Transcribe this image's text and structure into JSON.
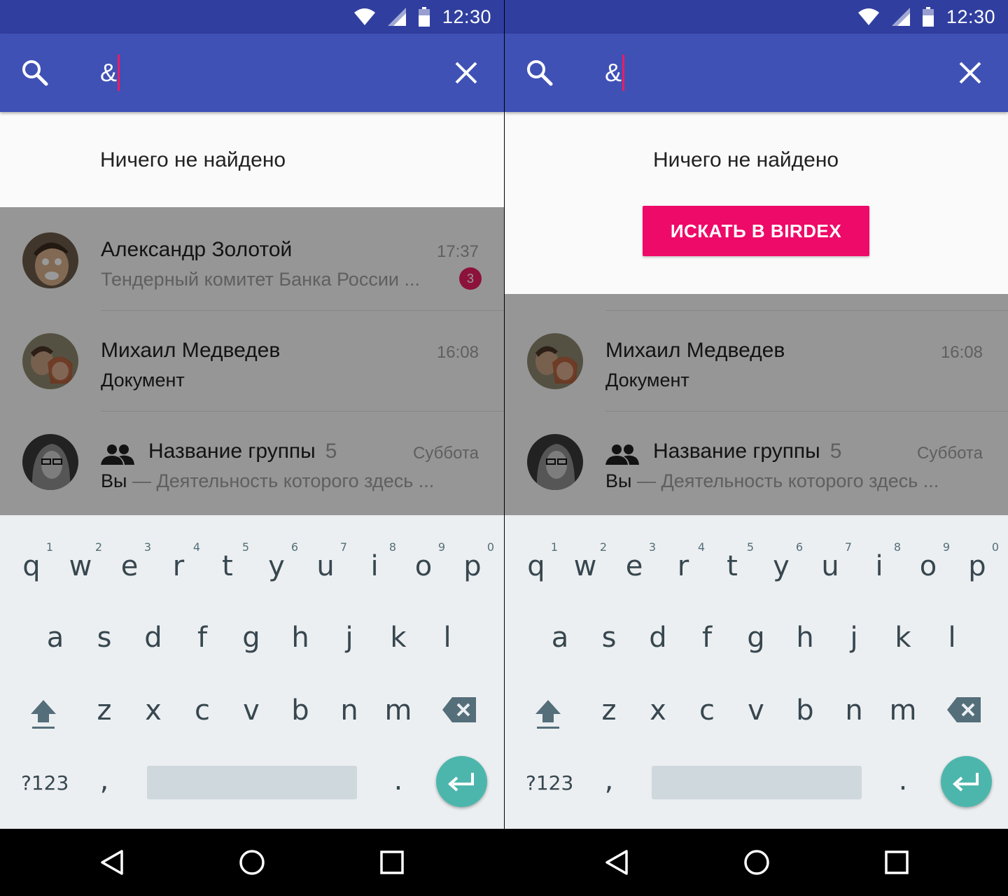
{
  "status_bar": {
    "time": "12:30"
  },
  "search": {
    "query": "&"
  },
  "empty_state": {
    "message": "Ничего не найдено"
  },
  "birdex_button": {
    "label": "ИСКАТЬ В BIRDEX"
  },
  "chats": [
    {
      "name": "Александр Золотой",
      "time": "17:37",
      "preview": "Тендерный комитет Банка России ...",
      "unread": "3"
    },
    {
      "name": "Михаил Медведев",
      "time": "16:08",
      "preview": "Документ"
    },
    {
      "name": "Название группы",
      "member_count": "5",
      "time": "Суббота",
      "sender": "Вы",
      "preview": "— Деятельность которого здесь ..."
    }
  ],
  "keyboard": {
    "row1": [
      {
        "key": "q",
        "hint": "1"
      },
      {
        "key": "w",
        "hint": "2"
      },
      {
        "key": "e",
        "hint": "3"
      },
      {
        "key": "r",
        "hint": "4"
      },
      {
        "key": "t",
        "hint": "5"
      },
      {
        "key": "y",
        "hint": "6"
      },
      {
        "key": "u",
        "hint": "7"
      },
      {
        "key": "i",
        "hint": "8"
      },
      {
        "key": "o",
        "hint": "9"
      },
      {
        "key": "p",
        "hint": "0"
      }
    ],
    "row2": [
      "a",
      "s",
      "d",
      "f",
      "g",
      "h",
      "j",
      "k",
      "l"
    ],
    "row3": [
      "z",
      "x",
      "c",
      "v",
      "b",
      "n",
      "m"
    ],
    "symbols_key": "?123",
    "comma_key": ",",
    "period_key": "."
  },
  "icons": {
    "search": "search-icon",
    "close": "close-icon",
    "wifi": "wifi-icon",
    "signal": "signal-icon",
    "battery": "battery-icon",
    "group": "group-icon",
    "shift": "shift-icon",
    "backspace": "backspace-icon",
    "enter": "enter-icon",
    "back": "back-icon",
    "home": "home-icon",
    "recents": "recents-icon"
  },
  "colors": {
    "status_bar": "#303f9f",
    "toolbar": "#3f51b5",
    "accent": "#ee0a68",
    "enter_key": "#4db6ac"
  }
}
